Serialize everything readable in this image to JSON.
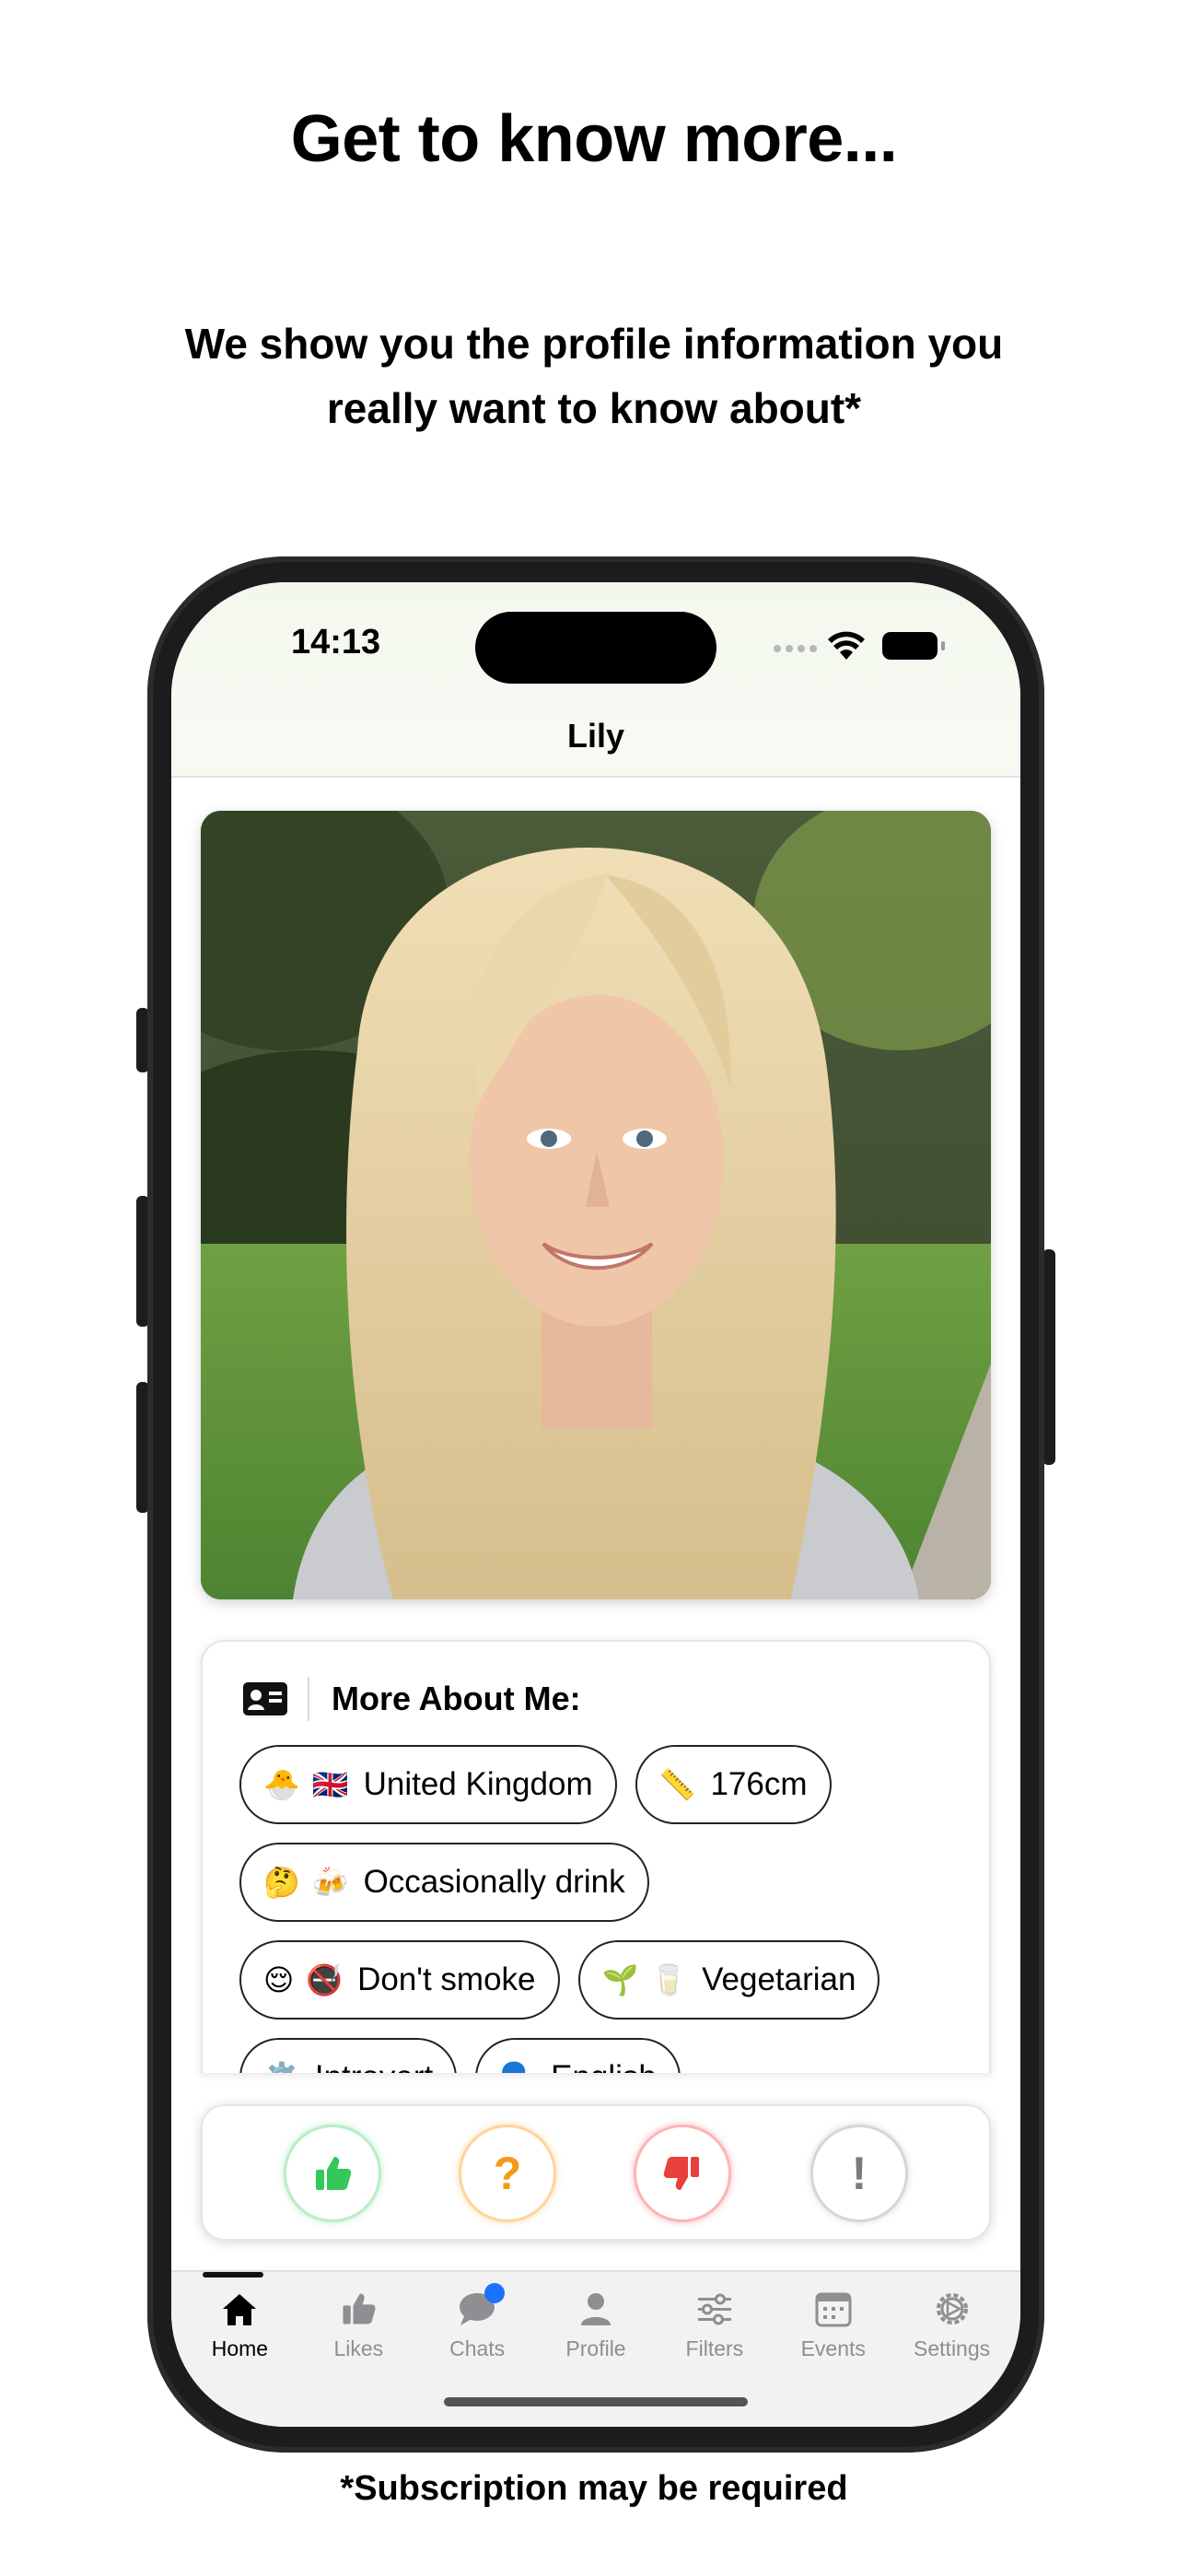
{
  "marketing": {
    "headline": "Get to know more...",
    "subheadline": "We show you the profile information you really want to know about*",
    "footnote": "*Subscription may be required"
  },
  "status_bar": {
    "time": "14:13"
  },
  "profile": {
    "name": "Lily",
    "photo_icon": "profile-photo"
  },
  "about": {
    "title": "More About Me:",
    "icon": "id-card-icon",
    "chips": [
      {
        "emoji": "🐣 🇬🇧",
        "label": "United Kingdom"
      },
      {
        "emoji": "📏",
        "label": "176cm"
      },
      {
        "emoji": "🤔 🍻",
        "label": "Occasionally drink"
      },
      {
        "emoji": "😌 🚭",
        "label": "Don't smoke"
      },
      {
        "emoji": "🌱 🥛",
        "label": "Vegetarian"
      },
      {
        "emoji": "⚙️",
        "label": "Introvert"
      },
      {
        "emoji": "🗣️",
        "label": "English"
      }
    ]
  },
  "actions": {
    "like_icon": "thumbs-up-icon",
    "question": "?",
    "dislike_icon": "thumbs-down-icon",
    "report": "!"
  },
  "tabs": [
    {
      "label": "Home",
      "icon": "home-icon",
      "active": true
    },
    {
      "label": "Likes",
      "icon": "thumbs-up-icon",
      "active": false
    },
    {
      "label": "Chats",
      "icon": "chat-icon",
      "active": false
    },
    {
      "label": "Profile",
      "icon": "person-icon",
      "active": false
    },
    {
      "label": "Filters",
      "icon": "sliders-icon",
      "active": false
    },
    {
      "label": "Events",
      "icon": "calendar-icon",
      "active": false
    },
    {
      "label": "Settings",
      "icon": "gear-icon",
      "active": false
    }
  ],
  "colors": {
    "like": "#34c759",
    "question": "#f59a18",
    "dislike": "#e8403a",
    "badge": "#1a73ff"
  }
}
